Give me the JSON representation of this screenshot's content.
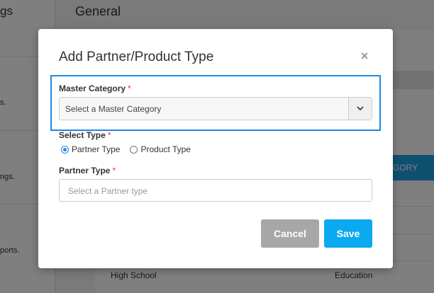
{
  "background": {
    "sidebar": {
      "title_fragment": "gs",
      "item1_fragment": "s.",
      "item2_fragment": "ngs.",
      "item3_fragment": "ports."
    },
    "main": {
      "heading": "General",
      "blue_button_fragment": "GORY",
      "row_left": "High School",
      "row_right": "Education"
    }
  },
  "modal": {
    "title": "Add Partner/Product Type",
    "close_glyph": "×",
    "master_category": {
      "label": "Master Category",
      "required_mark": "*",
      "selected_value": "Select a Master Category"
    },
    "select_type": {
      "label": "Select Type",
      "required_mark": "*",
      "options": [
        {
          "label": "Partner Type",
          "checked": true
        },
        {
          "label": "Product Type",
          "checked": false
        }
      ]
    },
    "partner_type": {
      "label": "Partner Type",
      "required_mark": "*",
      "placeholder": "Select a Partner type"
    },
    "buttons": {
      "cancel": "Cancel",
      "save": "Save"
    }
  },
  "colors": {
    "accent": "#1e88e5",
    "save": "#0baaf0",
    "cancel": "#a7a7a7",
    "required": "#e53935"
  }
}
